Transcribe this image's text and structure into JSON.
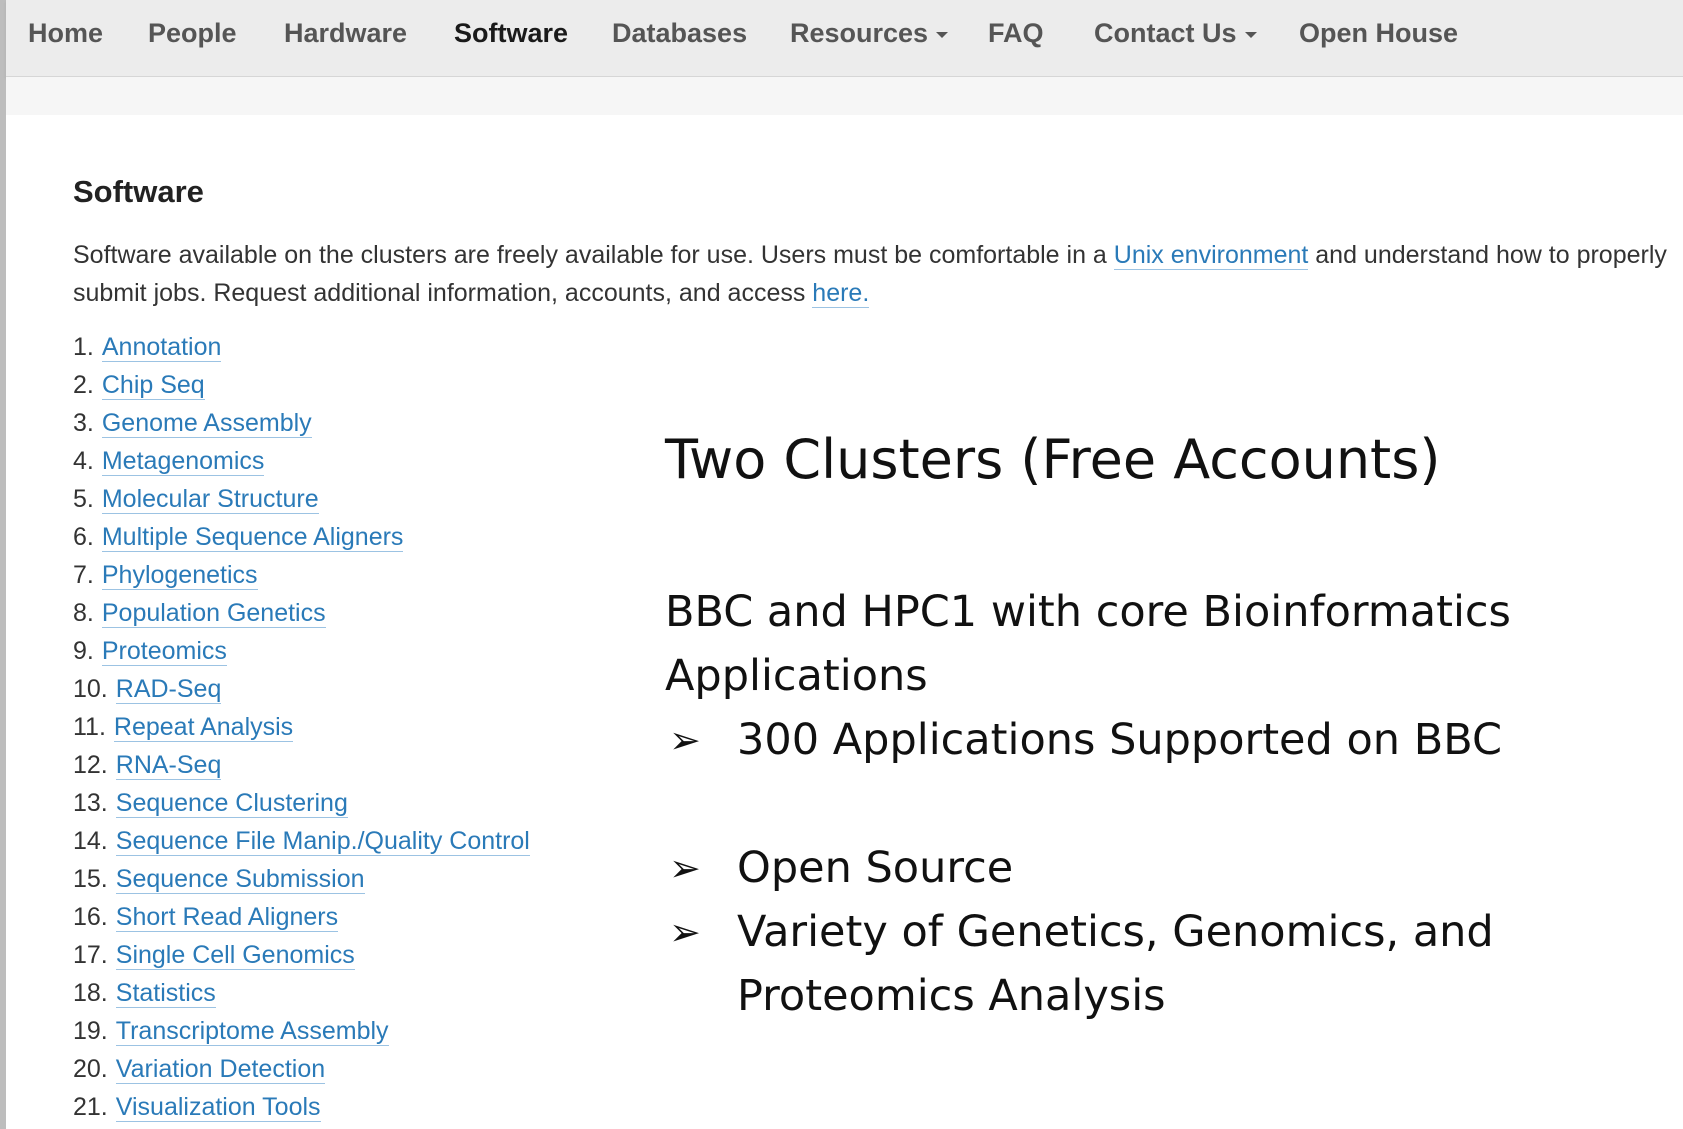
{
  "nav": {
    "items": [
      {
        "label": "Home"
      },
      {
        "label": "People"
      },
      {
        "label": "Hardware"
      },
      {
        "label": "Software"
      },
      {
        "label": "Databases"
      },
      {
        "label": "Resources"
      },
      {
        "label": "FAQ"
      },
      {
        "label": "Contact Us"
      },
      {
        "label": "Open House"
      }
    ],
    "active": "Software"
  },
  "page": {
    "heading": "Software",
    "intro_part1": "Software available on the clusters are freely available for use.  Users must be comfortable in a ",
    "intro_link1": "Unix environment",
    "intro_part2": " and understand how to properly submit jobs. Request additional information, accounts, and access ",
    "intro_link2": "here."
  },
  "software_list": [
    {
      "num": "1.",
      "label": "Annotation"
    },
    {
      "num": "2.",
      "label": "Chip Seq"
    },
    {
      "num": "3.",
      "label": "Genome Assembly"
    },
    {
      "num": "4.",
      "label": "Metagenomics"
    },
    {
      "num": "5.",
      "label": "Molecular Structure"
    },
    {
      "num": "6.",
      "label": "Multiple Sequence Aligners"
    },
    {
      "num": "7.",
      "label": "Phylogenetics"
    },
    {
      "num": "8.",
      "label": "Population Genetics"
    },
    {
      "num": "9.",
      "label": "Proteomics"
    },
    {
      "num": "10.",
      "label": "RAD-Seq"
    },
    {
      "num": "11.",
      "label": "Repeat Analysis"
    },
    {
      "num": "12.",
      "label": "RNA-Seq"
    },
    {
      "num": "13.",
      "label": "Sequence Clustering"
    },
    {
      "num": "14.",
      "label": "Sequence File Manip./Quality Control"
    },
    {
      "num": "15.",
      "label": "Sequence Submission"
    },
    {
      "num": "16.",
      "label": "Short Read Aligners"
    },
    {
      "num": "17.",
      "label": "Single Cell Genomics"
    },
    {
      "num": "18.",
      "label": "Statistics"
    },
    {
      "num": "19.",
      "label": "Transcriptome Assembly"
    },
    {
      "num": "20.",
      "label": "Variation Detection"
    },
    {
      "num": "21.",
      "label": "Visualization Tools"
    }
  ],
  "overlay": {
    "title": "Two Clusters (Free Accounts)",
    "paragraph": "BBC and HPC1 with core Bioinformatics Applications",
    "bullets": [
      "300 Applications Supported on BBC",
      "Open Source",
      "Variety of Genetics, Genomics, and Proteomics Analysis"
    ],
    "bullet_glyph": "➢"
  },
  "colors": {
    "link": "#2a7ab8",
    "navbar_bg": "#ececec",
    "text": "#333333"
  }
}
